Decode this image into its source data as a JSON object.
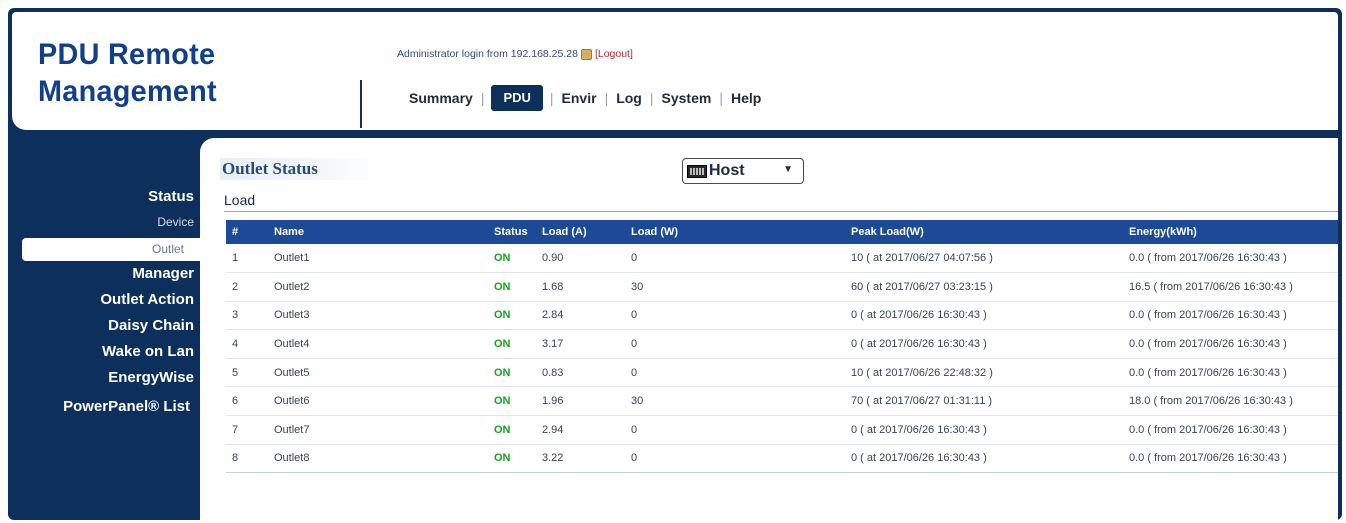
{
  "header": {
    "brand_line1": "PDU Remote",
    "brand_line2": "Management",
    "login_text": "Administrator login from 192.168.25.28",
    "logout_label": "[Logout]"
  },
  "nav": {
    "items": [
      {
        "label": "Summary",
        "active": false
      },
      {
        "label": "PDU",
        "active": true
      },
      {
        "label": "Envir",
        "active": false
      },
      {
        "label": "Log",
        "active": false
      },
      {
        "label": "System",
        "active": false
      },
      {
        "label": "Help",
        "active": false
      }
    ]
  },
  "sidebar": {
    "status": "Status",
    "device": "Device",
    "outlet": "Outlet",
    "manager": "Manager",
    "outlet_action": "Outlet Action",
    "daisy_chain": "Daisy Chain",
    "wake_on_lan": "Wake on Lan",
    "energywise": "EnergyWise",
    "powerpanel": "PowerPanel® List"
  },
  "panel": {
    "title": "Outlet Status",
    "host_select": "Host",
    "section": "Load"
  },
  "table": {
    "headers": [
      "#",
      "Name",
      "Status",
      "Load (A)",
      "Load (W)",
      "Peak Load(W)",
      "Energy(kWh)"
    ],
    "rows": [
      [
        "1",
        "Outlet1",
        "ON",
        "0.90",
        "0",
        "10 ( at 2017/06/27 04:07:56 )",
        "0.0 ( from 2017/06/26 16:30:43 )"
      ],
      [
        "2",
        "Outlet2",
        "ON",
        "1.68",
        "30",
        "60 ( at 2017/06/27 03:23:15 )",
        "16.5 ( from 2017/06/26 16:30:43 )"
      ],
      [
        "3",
        "Outlet3",
        "ON",
        "2.84",
        "0",
        "0 ( at 2017/06/26 16:30:43 )",
        "0.0 ( from 2017/06/26 16:30:43 )"
      ],
      [
        "4",
        "Outlet4",
        "ON",
        "3.17",
        "0",
        "0 ( at 2017/06/26 16:30:43 )",
        "0.0 ( from 2017/06/26 16:30:43 )"
      ],
      [
        "5",
        "Outlet5",
        "ON",
        "0.83",
        "0",
        "10 ( at 2017/06/26 22:48:32 )",
        "0.0 ( from 2017/06/26 16:30:43 )"
      ],
      [
        "6",
        "Outlet6",
        "ON",
        "1.96",
        "30",
        "70 ( at 2017/06/27 01:31:11 )",
        "18.0 ( from 2017/06/26 16:30:43 )"
      ],
      [
        "7",
        "Outlet7",
        "ON",
        "2.94",
        "0",
        "0 ( at 2017/06/26 16:30:43 )",
        "0.0 ( from 2017/06/26 16:30:43 )"
      ],
      [
        "8",
        "Outlet8",
        "ON",
        "3.22",
        "0",
        "0 ( at 2017/06/26 16:30:43 )",
        "0.0 ( from 2017/06/26 16:30:43 )"
      ]
    ]
  },
  "colors": {
    "navy": "#0c2f5c",
    "brand_blue": "#11408a",
    "table_header": "#1c4a97",
    "status_on": "#14a61c",
    "logout_red": "#c0282d"
  }
}
